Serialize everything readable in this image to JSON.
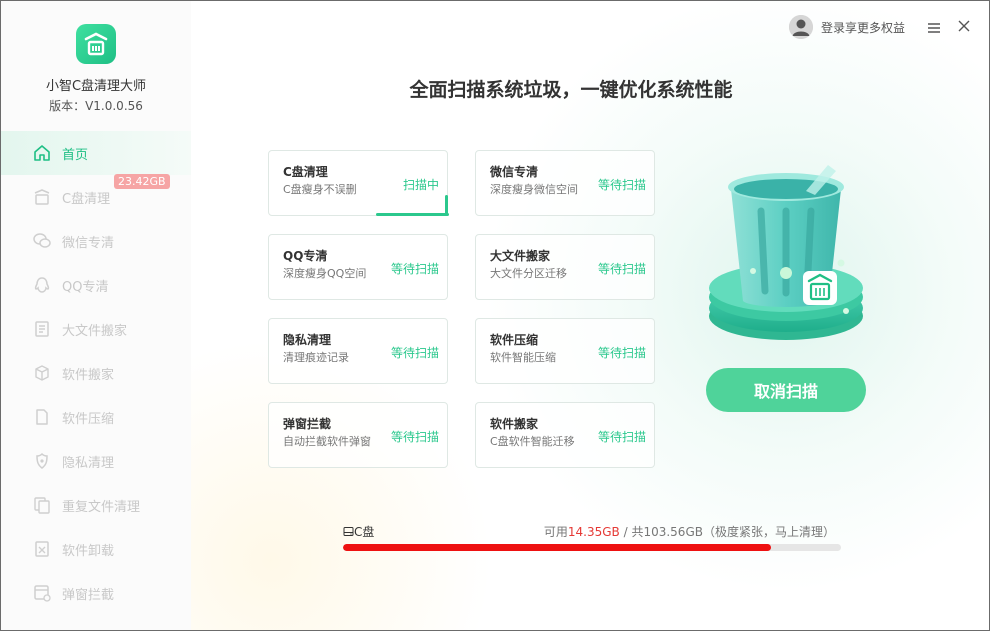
{
  "app": {
    "name": "小智C盘清理大师",
    "version": "版本：V1.0.0.56",
    "logo_glyph": "扫",
    "accent_color": "#1fbf85"
  },
  "sidebar": {
    "items": [
      {
        "label": "首页",
        "icon": "home-icon",
        "active": true
      },
      {
        "label": "C盘清理",
        "icon": "broom-icon",
        "badge": "23.42GB"
      },
      {
        "label": "微信专清",
        "icon": "wechat-icon"
      },
      {
        "label": "QQ专清",
        "icon": "qq-icon"
      },
      {
        "label": "大文件搬家",
        "icon": "big-file-icon"
      },
      {
        "label": "软件搬家",
        "icon": "box-icon"
      },
      {
        "label": "软件压缩",
        "icon": "compress-icon"
      },
      {
        "label": "隐私清理",
        "icon": "shield-icon"
      },
      {
        "label": "重复文件清理",
        "icon": "duplicate-icon"
      },
      {
        "label": "软件卸载",
        "icon": "uninstall-icon"
      },
      {
        "label": "弹窗拦截",
        "icon": "popup-block-icon"
      }
    ]
  },
  "topbar": {
    "login_text": "登录享更多权益"
  },
  "main": {
    "headline": "全面扫描系统垃圾，一键优化系统性能",
    "cards": [
      {
        "title": "C盘清理",
        "desc": "C盘瘦身不误删",
        "status": "扫描中",
        "scanning": true
      },
      {
        "title": "微信专清",
        "desc": "深度瘦身微信空间",
        "status": "等待扫描"
      },
      {
        "title": "QQ专清",
        "desc": "深度瘦身QQ空间",
        "status": "等待扫描"
      },
      {
        "title": "大文件搬家",
        "desc": "大文件分区迁移",
        "status": "等待扫描"
      },
      {
        "title": "隐私清理",
        "desc": "清理痕迹记录",
        "status": "等待扫描"
      },
      {
        "title": "软件压缩",
        "desc": "软件智能压缩",
        "status": "等待扫描"
      },
      {
        "title": "弹窗拦截",
        "desc": "自动拦截软件弹窗",
        "status": "等待扫描"
      },
      {
        "title": "软件搬家",
        "desc": "C盘软件智能迁移",
        "status": "等待扫描"
      }
    ],
    "cancel_label": "取消扫描",
    "trash_glyph": "扫"
  },
  "disk": {
    "label": "C盘",
    "available_prefix": "可用",
    "available": "14.35GB",
    "separator": " / ",
    "total": "共103.56GB",
    "note": "（极度紧张，马上清理）",
    "used_fraction": 0.86,
    "fill_color": "#ee1111"
  }
}
